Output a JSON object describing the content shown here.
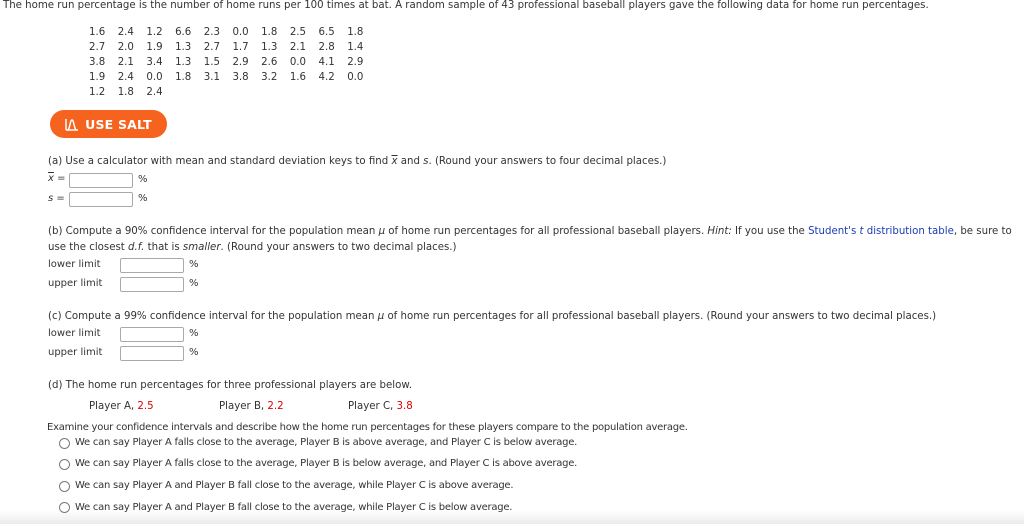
{
  "intro": "The home run percentage is the number of home runs per 100 times at bat. A random sample of 43 professional baseball players gave the following data for home run percentages.",
  "data_rows": [
    [
      "1.6",
      "2.4",
      "1.2",
      "6.6",
      "2.3",
      "0.0",
      "1.8",
      "2.5",
      "6.5",
      "1.8"
    ],
    [
      "2.7",
      "2.0",
      "1.9",
      "1.3",
      "2.7",
      "1.7",
      "1.3",
      "2.1",
      "2.8",
      "1.4"
    ],
    [
      "3.8",
      "2.1",
      "3.4",
      "1.3",
      "1.5",
      "2.9",
      "2.6",
      "0.0",
      "4.1",
      "2.9"
    ],
    [
      "1.9",
      "2.4",
      "0.0",
      "1.8",
      "3.1",
      "3.8",
      "3.2",
      "1.6",
      "4.2",
      "0.0"
    ],
    [
      "1.2",
      "1.8",
      "2.4"
    ]
  ],
  "salt_button": {
    "label": "USE SALT",
    "icon": "salt-curve-icon",
    "color": "#f5631f"
  },
  "part_a": {
    "prefix": "(a) Use a calculator with mean and standard deviation keys to find ",
    "xbar": "x",
    "mid": " and ",
    "s": "s",
    "suffix": ". (Round your answers to four decimal places.)",
    "fields": [
      {
        "label_var": "x",
        "label_eq": " =",
        "value": "",
        "unit": "%"
      },
      {
        "label_var": "s",
        "label_eq": " =",
        "value": "",
        "unit": "%"
      }
    ]
  },
  "part_b": {
    "line1_prefix": "(b) Compute a 90% confidence interval for the population mean ",
    "mu": "μ",
    "line1_mid": " of home run percentages for all professional baseball players. ",
    "hint": "Hint:",
    "line1_after_hint": " If you use the ",
    "link_pre": "Student's ",
    "link_t": "t",
    "link_post": " distribution table",
    "line1_end": ", be sure to",
    "line2_prefix": "use the closest ",
    "df": "d.f.",
    "line2_mid": " that is ",
    "smaller": "smaller",
    "line2_end": ". (Round your answers to two decimal places.)",
    "fields": [
      {
        "label": "lower limit",
        "value": "",
        "unit": "%"
      },
      {
        "label": "upper limit",
        "value": "",
        "unit": "%"
      }
    ]
  },
  "part_c": {
    "prefix": "(c) Compute a 99% confidence interval for the population mean ",
    "mu": "μ",
    "suffix": " of home run percentages for all professional baseball players. (Round your answers to two decimal places.)",
    "fields": [
      {
        "label": "lower limit",
        "value": "",
        "unit": "%"
      },
      {
        "label": "upper limit",
        "value": "",
        "unit": "%"
      }
    ]
  },
  "part_d": {
    "intro": "(d) The home run percentages for three professional players are below.",
    "players": [
      {
        "name": "Player A, ",
        "value": "2.5"
      },
      {
        "name": "Player B, ",
        "value": "2.2"
      },
      {
        "name": "Player C, ",
        "value": "3.8"
      }
    ],
    "question": "Examine your confidence intervals and describe how the home run percentages for these players compare to the population average.",
    "options": [
      "We can say Player A falls close to the average, Player B is above average, and Player C is below average.",
      "We can say Player A falls close to the average, Player B is below average, and Player C is above average.",
      "We can say Player A and Player B fall close to the average, while Player C is above average.",
      "We can say Player A and Player B fall close to the average, while Player C is below average."
    ]
  }
}
